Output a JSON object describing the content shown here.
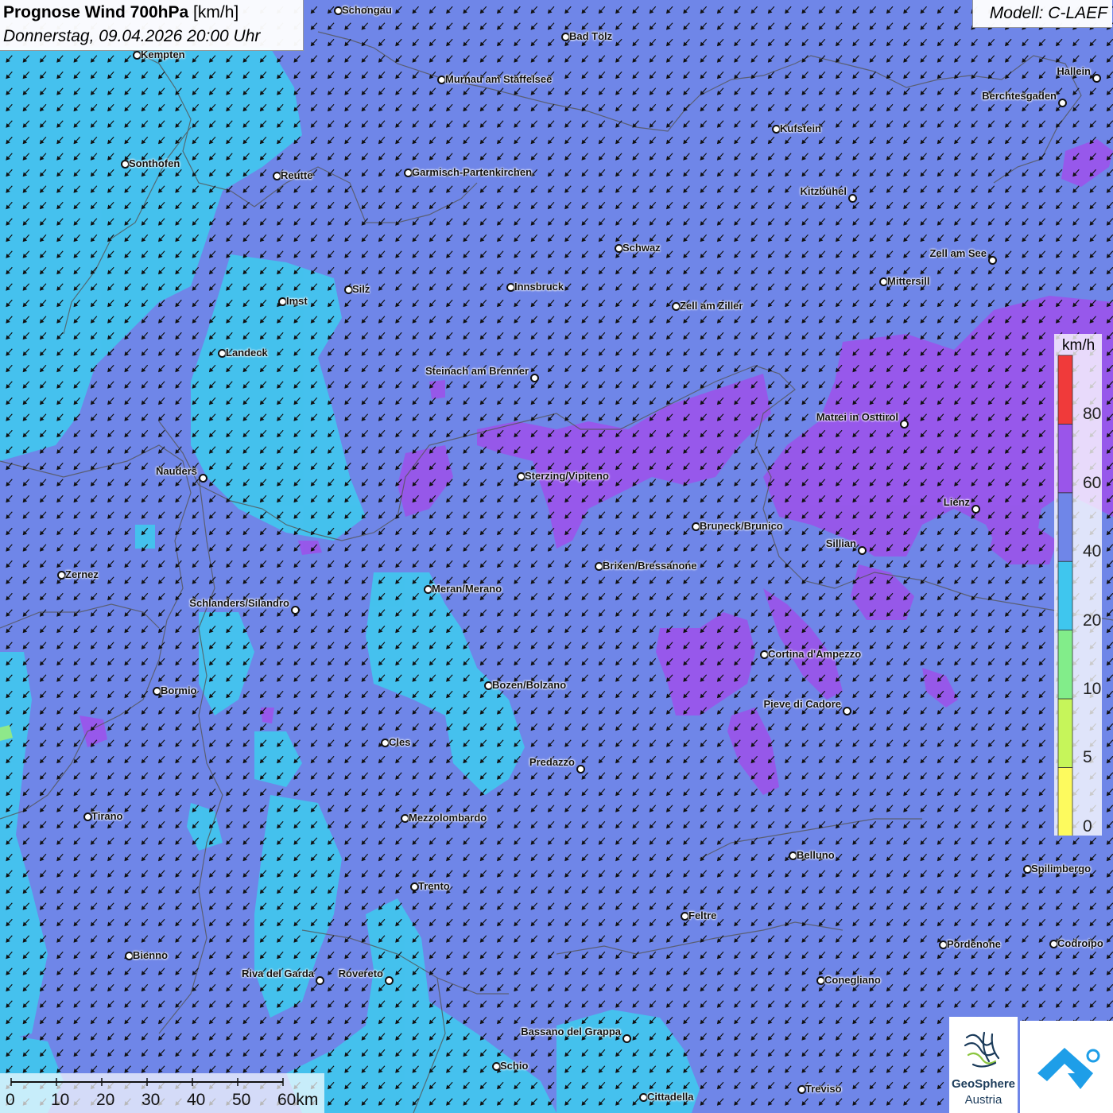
{
  "title": {
    "main": "Prognose Wind 700hPa",
    "unit": " [km/h]",
    "date": "Donnerstag, 09.04.2026 20:00 Uhr"
  },
  "model": "Modell: C-LAEF",
  "legend": {
    "unit": "km/h",
    "bands": [
      {
        "from": 0,
        "to": 5,
        "color": "#fdfa5e"
      },
      {
        "from": 5,
        "to": 10,
        "color": "#c6f55a"
      },
      {
        "from": 10,
        "to": 20,
        "color": "#82ed8a"
      },
      {
        "from": 20,
        "to": 40,
        "color": "#3fc6ee"
      },
      {
        "from": 40,
        "to": 60,
        "color": "#6f86e8"
      },
      {
        "from": 60,
        "to": 80,
        "color": "#9a55ea"
      },
      {
        "from": 80,
        "to": 100,
        "color": "#f03a3a"
      }
    ],
    "labels": [
      "0",
      "5",
      "10",
      "20",
      "40",
      "60",
      "80"
    ]
  },
  "scale": [
    "0",
    "10",
    "20",
    "30",
    "40",
    "50",
    "60km"
  ],
  "logos": {
    "geosphere": "GeoSphere",
    "austria": "Austria"
  },
  "colors": {
    "background": "#6f86e8",
    "low_wind": "#40c8ee",
    "high_wind": "#9a55ea",
    "arrow": "#111111"
  },
  "cities": [
    {
      "name": "Schongau",
      "label_side": "right"
    },
    {
      "name": "Bad Tölz",
      "label_side": "right"
    },
    {
      "name": "Kempten",
      "label_side": "right"
    },
    {
      "name": "Murnau am Staffelsee",
      "label_side": "right"
    },
    {
      "name": "Hallein",
      "label_side": "left"
    },
    {
      "name": "Berchtesgaden",
      "label_side": "left"
    },
    {
      "name": "Kufstein",
      "label_side": "right"
    },
    {
      "name": "Sonthofen",
      "label_side": "right"
    },
    {
      "name": "Reutte",
      "label_side": "right"
    },
    {
      "name": "Garmisch-Partenkirchen",
      "label_side": "right"
    },
    {
      "name": "Kitzbühel",
      "label_side": "left"
    },
    {
      "name": "Schwaz",
      "label_side": "right"
    },
    {
      "name": "Zell am See",
      "label_side": "left"
    },
    {
      "name": "Mittersill",
      "label_side": "right"
    },
    {
      "name": "Innsbruck",
      "label_side": "right"
    },
    {
      "name": "Silz",
      "label_side": "right"
    },
    {
      "name": "Imst",
      "label_side": "right"
    },
    {
      "name": "Zell am Ziller",
      "label_side": "right"
    },
    {
      "name": "Landeck",
      "label_side": "right"
    },
    {
      "name": "Steinach am Brenner",
      "label_side": "left"
    },
    {
      "name": "Matrei in Osttirol",
      "label_side": "left"
    },
    {
      "name": "Nauders",
      "label_side": "left"
    },
    {
      "name": "Sterzing/Vipiteno",
      "label_side": "right"
    },
    {
      "name": "Lienz",
      "label_side": "left"
    },
    {
      "name": "Bruneck/Brunico",
      "label_side": "right"
    },
    {
      "name": "Sillian",
      "label_side": "left"
    },
    {
      "name": "Brixen/Bressanone",
      "label_side": "right"
    },
    {
      "name": "Zernez",
      "label_side": "right"
    },
    {
      "name": "Meran/Merano",
      "label_side": "right"
    },
    {
      "name": "Schlanders/Silandro",
      "label_side": "left"
    },
    {
      "name": "Cortina d'Ampezzo",
      "label_side": "right"
    },
    {
      "name": "Bozen/Bolzano",
      "label_side": "right"
    },
    {
      "name": "Bormio",
      "label_side": "right"
    },
    {
      "name": "Pieve di Cadore",
      "label_side": "left"
    },
    {
      "name": "Cles",
      "label_side": "right"
    },
    {
      "name": "Predazzo",
      "label_side": "left"
    },
    {
      "name": "Tirano",
      "label_side": "right"
    },
    {
      "name": "Mezzolombardo",
      "label_side": "right"
    },
    {
      "name": "Belluno",
      "label_side": "right"
    },
    {
      "name": "Spilimbergo",
      "label_side": "right"
    },
    {
      "name": "Trento",
      "label_side": "right"
    },
    {
      "name": "Feltre",
      "label_side": "right"
    },
    {
      "name": "Pordenone",
      "label_side": "right"
    },
    {
      "name": "Codroipo",
      "label_side": "right"
    },
    {
      "name": "Bienno",
      "label_side": "right"
    },
    {
      "name": "Riva del Garda",
      "label_side": "left"
    },
    {
      "name": "Rovereto",
      "label_side": "left"
    },
    {
      "name": "Conegliano",
      "label_side": "right"
    },
    {
      "name": "Bassano del Grappa",
      "label_side": "left"
    },
    {
      "name": "Schio",
      "label_side": "right"
    },
    {
      "name": "Treviso",
      "label_side": "right"
    },
    {
      "name": "Cittadella",
      "label_side": "right"
    }
  ]
}
